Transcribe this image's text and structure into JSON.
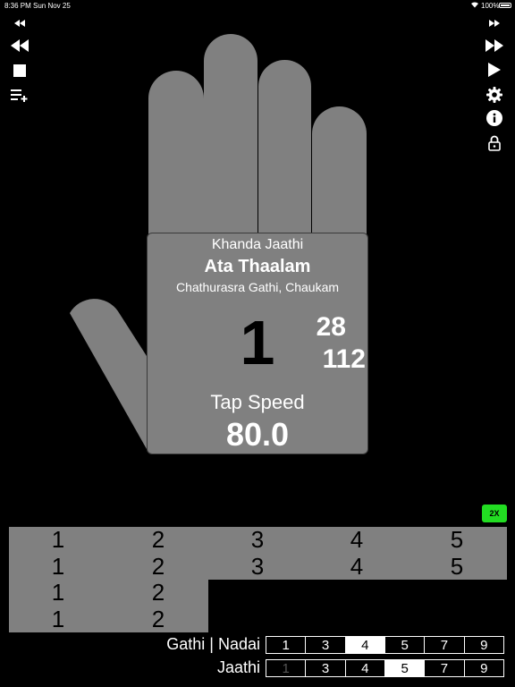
{
  "status_bar": {
    "time": "8:36 PM",
    "date": "Sun Nov 25",
    "battery": "100%"
  },
  "toolbar_icons": {
    "left": [
      "rewind-small-icon",
      "rewind-icon",
      "stop-icon",
      "playlist-add-icon"
    ],
    "right": [
      "fast-forward-small-icon",
      "fast-forward-icon",
      "play-icon",
      "gear-icon",
      "info-icon",
      "lock-icon"
    ]
  },
  "palm": {
    "jaathi_name": "Khanda Jaathi",
    "thaalam_name": "Ata Thaalam",
    "gathi_line": "Chathurasra Gathi, Chaukam",
    "current_beat": "1",
    "count_top": "28",
    "count_bottom": "112",
    "tap_speed_label": "Tap Speed",
    "tap_speed_value": "80.0"
  },
  "speed_multiplier": "2X",
  "beat_grid": {
    "rows": [
      [
        "1",
        "2",
        "3",
        "4",
        "5"
      ],
      [
        "1",
        "2",
        "3",
        "4",
        "5"
      ],
      [
        "1",
        "2"
      ],
      [
        "1",
        "2"
      ]
    ]
  },
  "gathi_selector": {
    "label": "Gathi | Nadai",
    "options": [
      "1",
      "3",
      "4",
      "5",
      "7",
      "9"
    ],
    "selected": "4"
  },
  "jaathi_selector": {
    "label": "Jaathi",
    "options": [
      "1",
      "3",
      "4",
      "5",
      "7",
      "9"
    ],
    "selected": "5",
    "disabled": [
      "1"
    ]
  },
  "colors": {
    "background": "#000000",
    "hand": "#808080",
    "badge": "#22dd22",
    "selected_segment": "#ffffff"
  }
}
